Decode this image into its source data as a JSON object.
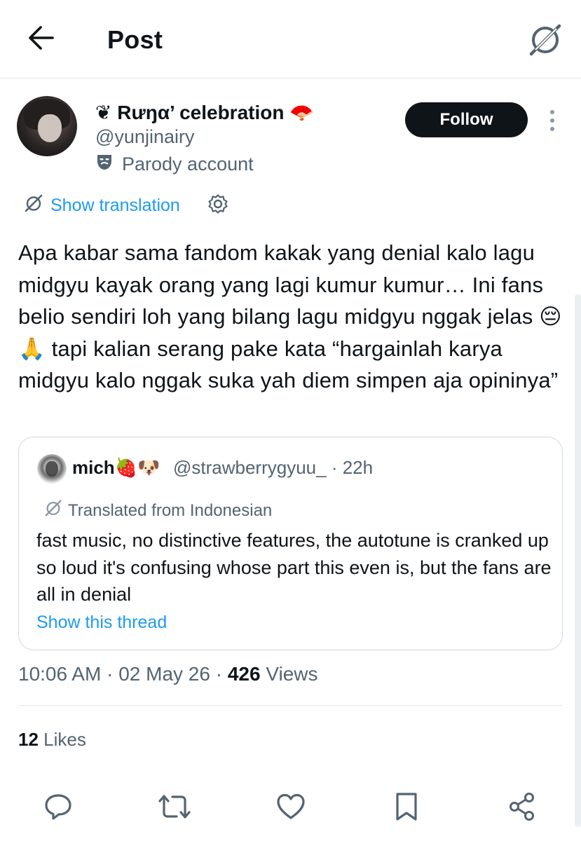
{
  "header": {
    "title": "Post"
  },
  "author": {
    "name": "❦ Rưŋα’ celebration 🪭",
    "handle": "@yunjinairy",
    "parody_label": "Parody account",
    "follow_label": "Follow"
  },
  "translation": {
    "show_label": "Show translation"
  },
  "post": {
    "text": "Apa kabar sama fandom kakak yang denial kalo lagu midgyu kayak orang yang lagi kumur kumur… Ini fans belio sendiri loh yang bilang lagu midgyu nggak jelas 😔🙏 tapi kalian serang pake kata “hargainlah karya midgyu kalo nggak suka yah diem simpen aja opininya”",
    "time": "10:06 AM",
    "date": "02 May 26",
    "views_count": "426",
    "views_label": "Views",
    "likes_count": "12",
    "likes_label": "Likes"
  },
  "quote": {
    "name": "mich🍓🐶",
    "handle": "@strawberrygyuu_",
    "age": "22h",
    "translated_label": "Translated from Indonesian",
    "text": "fast music, no distinctive features, the autotune is cranked up so loud it's confusing whose part this even is, but the fans are all in denial",
    "thread_label": "Show this thread"
  },
  "colors": {
    "accent": "#1d9bf0",
    "text": "#0f1419",
    "muted": "#536471",
    "border": "#cfd9de"
  },
  "icons": [
    "back-arrow-icon",
    "grok-icon",
    "more-icon",
    "translate-icon",
    "gear-icon",
    "parody-mask-icon",
    "reply-icon",
    "repost-icon",
    "like-icon",
    "bookmark-icon",
    "share-icon"
  ]
}
